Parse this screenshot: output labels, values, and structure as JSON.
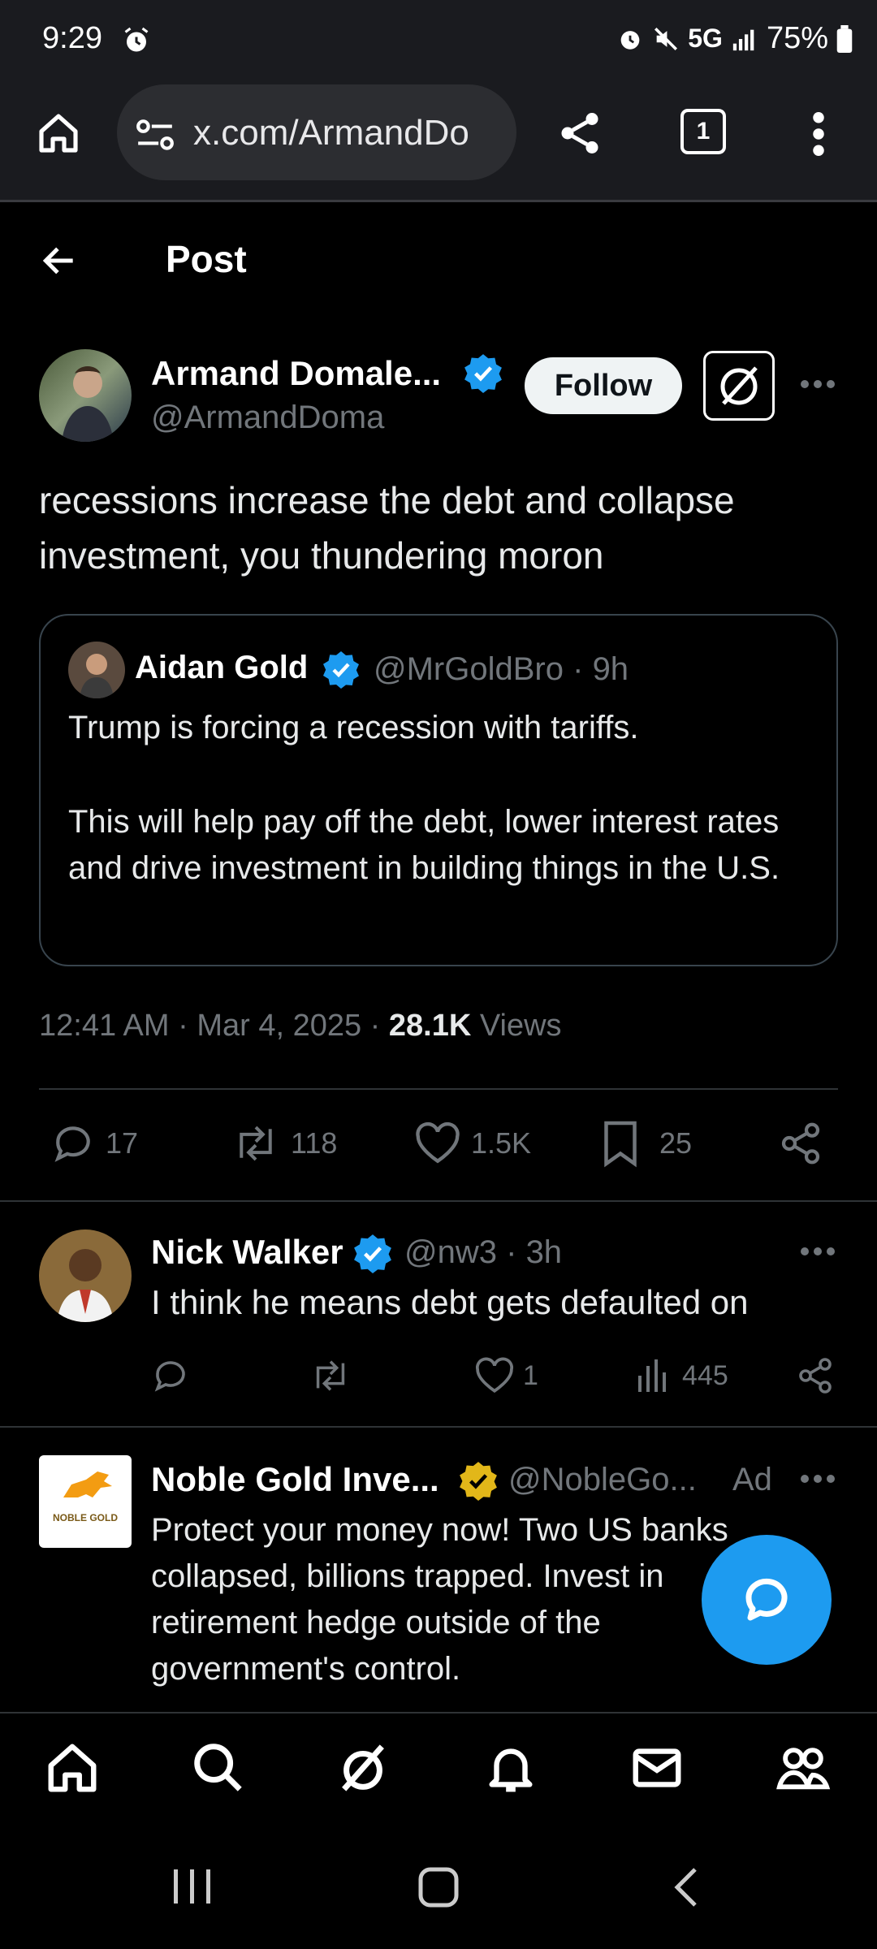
{
  "status_bar": {
    "time": "9:29",
    "network": "5G",
    "battery": "75%"
  },
  "browser": {
    "url": "x.com/ArmandDo",
    "tab_count": "1"
  },
  "header": {
    "title": "Post"
  },
  "post": {
    "author_name": "Armand Domale...",
    "author_handle": "@ArmandDoma",
    "follow_label": "Follow",
    "text": "recessions increase the debt and collapse investment, you thundering moron",
    "quote": {
      "author_name": "Aidan Gold",
      "author_handle": "@MrGoldBro",
      "sep": "·",
      "time": "9h",
      "line1": "Trump is forcing a recession with tariffs.",
      "line2": "This will help pay off the debt, lower interest rates and drive investment in building things in the U.S."
    },
    "timestamp": "12:41 AM · Mar 4, 2025 · ",
    "views_count": "28.1K",
    "views_label": " Views",
    "actions": {
      "replies": "17",
      "reposts": "118",
      "likes": "1.5K",
      "bookmarks": "25"
    }
  },
  "reply": {
    "author_name": "Nick Walker",
    "author_handle": "@nw3",
    "sep": "·",
    "time": "3h",
    "text": "I think he means debt gets defaulted on",
    "likes": "1",
    "views": "445"
  },
  "ad": {
    "author_name": "Noble Gold Inve...",
    "author_handle": "@NobleGo...",
    "ad_label": "Ad",
    "logo_text": "NOBLE GOLD",
    "text": "Protect your money now! Two US banks collapsed, billions trapped. Invest in retirement hedge outside of the government's control."
  },
  "colors": {
    "accent": "#1d9bf0",
    "verified_gold": "#e2b719",
    "background": "#000000",
    "muted": "#71767b"
  }
}
